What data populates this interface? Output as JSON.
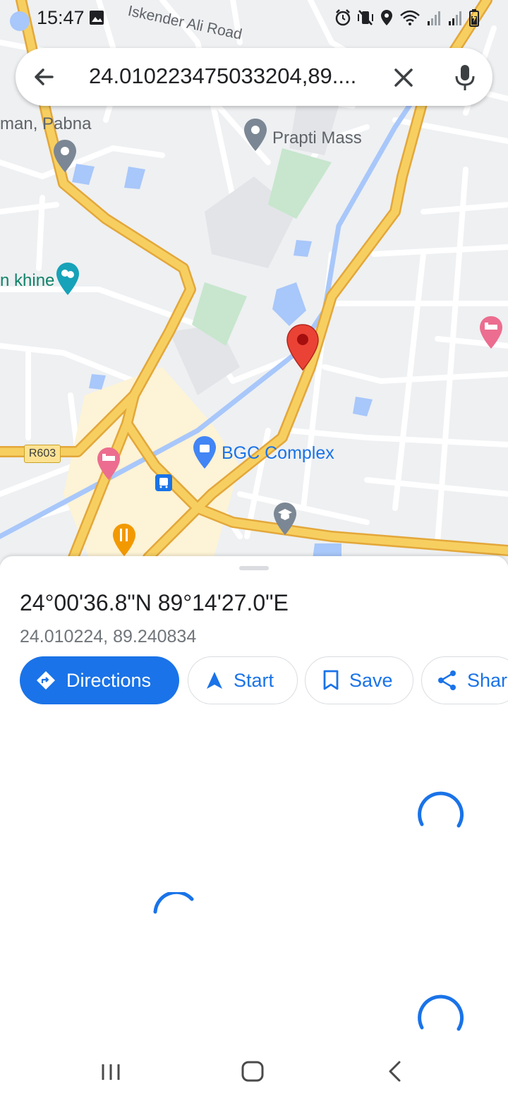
{
  "status_bar": {
    "time": "15:47",
    "icons": [
      "gallery-icon",
      "alarm-icon",
      "vibrate-mute-icon",
      "location-icon",
      "wifi-icon",
      "signal-icon",
      "signal-icon",
      "battery-icon"
    ]
  },
  "search": {
    "query": "24.010223475033204,89....",
    "icons": [
      "back-arrow-icon",
      "close-icon",
      "mic-icon"
    ]
  },
  "map": {
    "labels": {
      "road_top": "Iskender Ali Road",
      "pabna": "man, Pabna",
      "prapti": "Prapti Mass",
      "khine": "n khine",
      "bgc": "BGC Complex",
      "road_shield": "R603"
    },
    "colors": {
      "road_major": "#f5c24b",
      "road_minor": "#ffffff",
      "park": "#c7e6cd",
      "water": "#a8c7fa",
      "pin": "#ea4335"
    }
  },
  "place": {
    "coords_dms": "24°00'36.8\"N 89°14'27.0\"E",
    "coords_decimal": "24.010224, 89.240834"
  },
  "actions": {
    "directions": "Directions",
    "start": "Start",
    "save": "Save",
    "share": "Share"
  },
  "theme": {
    "accent": "#1a73e8"
  }
}
